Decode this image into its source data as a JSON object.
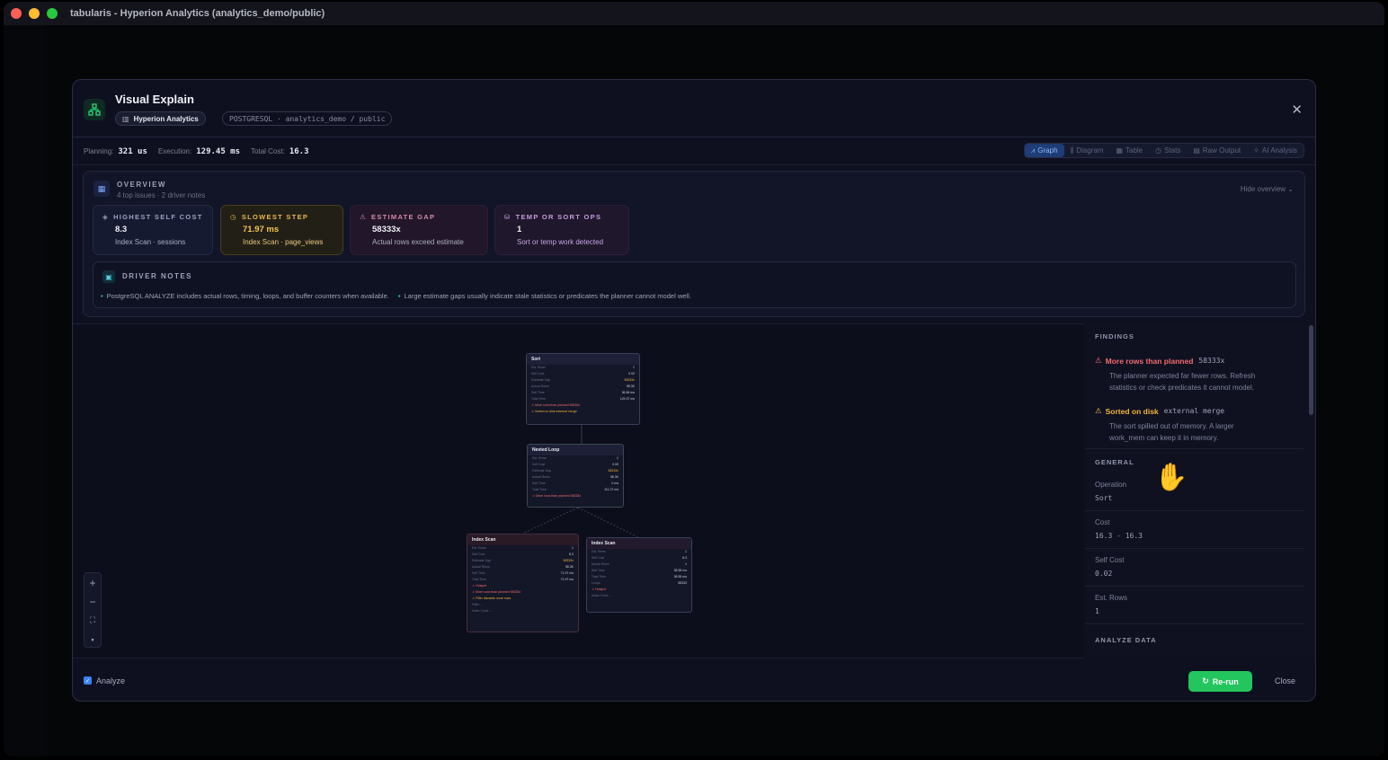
{
  "window": {
    "title": "tabularis - Hyperion Analytics (analytics_demo/public)"
  },
  "modal": {
    "title": "Visual Explain",
    "connection": "Hyperion Analytics",
    "context": "POSTGRESQL · analytics_demo / public"
  },
  "stats": {
    "planning_label": "Planning:",
    "planning_value": "321 us",
    "execution_label": "Execution:",
    "execution_value": "129.45 ms",
    "cost_label": "Total Cost:",
    "cost_value": "16.3"
  },
  "tabs": [
    "Graph",
    "Diagram",
    "Table",
    "Stats",
    "Raw Output",
    "AI Analysis"
  ],
  "overview": {
    "title": "OVERVIEW",
    "subtitle": "4 top issues · 2 driver notes",
    "hide_label": "Hide overview",
    "cards": [
      {
        "title": "HIGHEST SELF COST",
        "value": "8.3",
        "sub": "Index Scan · sessions"
      },
      {
        "title": "SLOWEST STEP",
        "value": "71.97 ms",
        "sub": "Index Scan · page_views"
      },
      {
        "title": "ESTIMATE GAP",
        "value": "58333x",
        "sub": "Actual rows exceed estimate"
      },
      {
        "title": "TEMP OR SORT OPS",
        "value": "1",
        "sub": "Sort or temp work detected"
      }
    ],
    "driver_title": "DRIVER NOTES",
    "driver_notes": [
      "PostgreSQL ANALYZE includes actual rows, timing, loops, and buffer counters when available.",
      "Large estimate gaps usually indicate stale statistics or predicates the planner cannot model well."
    ]
  },
  "graph": {
    "nodes": [
      {
        "title": "Sort"
      },
      {
        "title": "Nested Loop"
      },
      {
        "title": "Index Scan"
      },
      {
        "title": "Index Scan"
      }
    ]
  },
  "sidebar": {
    "findings_title": "FINDINGS",
    "findings": [
      {
        "title": "More rows than planned",
        "badge": "58333x",
        "line1": "The planner expected far fewer rows. Refresh",
        "line2": "statistics or check predicates it cannot model."
      },
      {
        "title": "Sorted on disk",
        "badge": "external merge",
        "line1": "The sort spilled out of memory. A larger",
        "line2": "work_mem can keep it in memory."
      }
    ],
    "general_title": "GENERAL",
    "general": [
      {
        "label": "Operation",
        "value": "Sort"
      },
      {
        "label": "Cost",
        "value": "16.3 - 16.3"
      },
      {
        "label": "Self Cost",
        "value": "0.02"
      },
      {
        "label": "Est. Rows",
        "value": "1"
      }
    ],
    "analyze_title": "ANALYZE DATA"
  },
  "footer": {
    "analyze_label": "Analyze",
    "rerun_label": "Re-run",
    "close_label": "Close"
  }
}
